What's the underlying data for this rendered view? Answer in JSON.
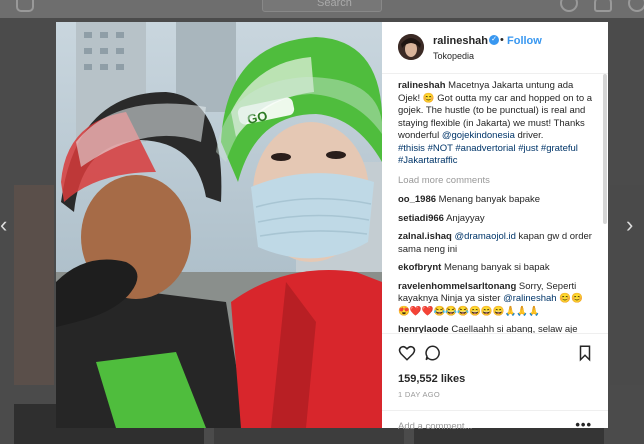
{
  "topbar": {
    "search_placeholder": "Search"
  },
  "post": {
    "username": "ralineshah",
    "follow_label": "Follow",
    "location": "Tokopedia",
    "caption": {
      "username": "ralineshah",
      "text_1": " Macetnya Jakarta untung ada Ojek! 😊 ",
      "text_2": " Got outta my car and hopped on to a gojek. The hustle (to be punctual) is real and staying flexible (in Jakarta) we must!",
      "text_3": " Thanks wonderful ",
      "mention": "@gojekindonesia",
      "text_4": " driver.",
      "hashtags": "#thisis #NOT #anadvertorial #just #grateful #Jakartatraffic"
    },
    "load_more": "Load more comments",
    "comments": [
      {
        "user": "oo_1986",
        "text": "Menang banyak bapake"
      },
      {
        "user": "setiadi966",
        "text": "Anjayyay"
      },
      {
        "user": "zalnal.ishaq",
        "mention": "@dramaojol.id",
        "text": " kapan gw d order sama neng ini"
      },
      {
        "user": "ekofbrynt",
        "text": "Menang banyak si bapak"
      },
      {
        "user": "ravelenhommelsarltonang",
        "text": "Sorry, Seperti kayaknya Ninja ya sister ",
        "mention": "@ralineshah",
        "emoji": " 😊😊 😍❤️❤️😂😂😂😄😄😄🙏🙏🙏"
      },
      {
        "user": "henrylaode",
        "text": "Caellaahh si abang, selaw aje"
      }
    ],
    "likes": "159,552 likes",
    "time_ago": "1 DAY AGO",
    "add_comment_placeholder": "Add a comment...",
    "more_options": "•••",
    "icons": [
      "heart-icon",
      "comment-icon",
      "bookmark-icon",
      "prev-arrow-icon",
      "next-arrow-icon"
    ],
    "colors": {
      "accent": "#3897f0",
      "text": "#262626",
      "muted": "#999999",
      "helmet_green": "#4fbd3d"
    }
  }
}
